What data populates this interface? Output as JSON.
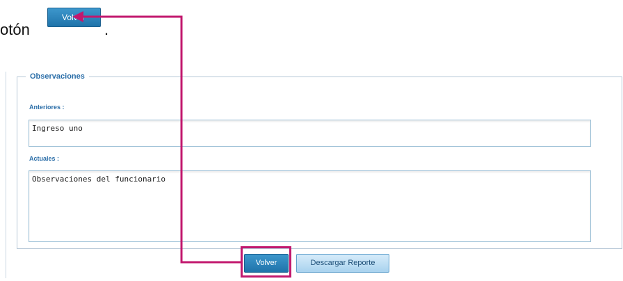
{
  "intro": {
    "text": "otón",
    "trailing": "."
  },
  "inline_button": {
    "label": "Volver"
  },
  "observaciones": {
    "legend": "Observaciones",
    "anteriores_label": "Anteriores :",
    "anteriores_value": "Ingreso uno",
    "actuales_label": "Actuales :",
    "actuales_value": "Observaciones del funcionario"
  },
  "actions": {
    "volver_label": "Volver",
    "descargar_label": "Descargar Reporte"
  },
  "colors": {
    "annotation": "#c2186e",
    "legend": "#2b6ea8",
    "primary_button": "#1f73aa",
    "secondary_button": "#a8d2ee"
  }
}
